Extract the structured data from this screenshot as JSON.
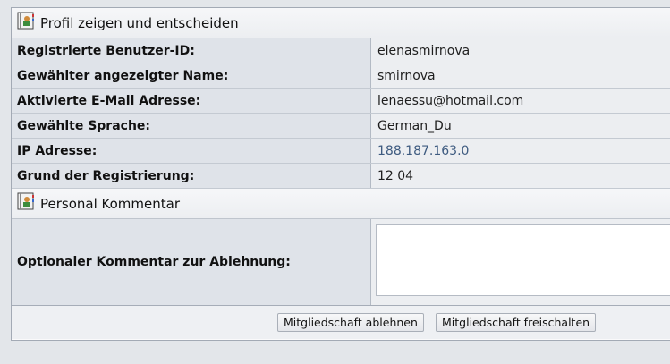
{
  "profile_section": {
    "title": "Profil zeigen und entscheiden",
    "icon": "address-book-icon",
    "rows": [
      {
        "label": "Registrierte Benutzer-ID:",
        "value": "elenasmirnova"
      },
      {
        "label": "Gewählter angezeigter Name:",
        "value": "smirnova"
      },
      {
        "label": "Aktivierte E-Mail Adresse:",
        "value": "lenaessu@hotmail.com"
      },
      {
        "label": "Gewählte Sprache:",
        "value": "German_Du"
      },
      {
        "label": "IP Adresse:",
        "value": "188.187.163.0"
      },
      {
        "label": "Grund der Registrierung:",
        "value": "12 04"
      }
    ]
  },
  "comment_section": {
    "title": "Personal Kommentar",
    "icon": "address-book-icon",
    "label": "Optionaler Kommentar zur Ablehnung:",
    "value": ""
  },
  "actions": {
    "reject_label": "Mitgliedschaft ablehnen",
    "approve_label": "Mitgliedschaft freischalten"
  },
  "colors": {
    "link": "#3e5b80",
    "label_bg": "#dfe3e9",
    "value_bg": "#eceef1"
  }
}
